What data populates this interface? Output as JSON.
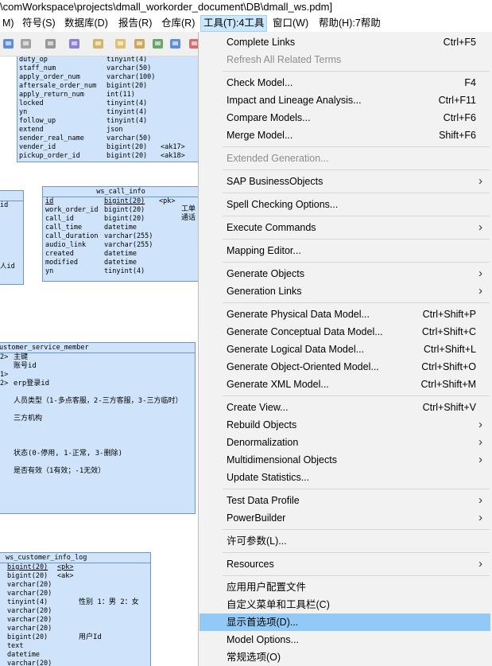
{
  "window": {
    "title": "\\comWorkspace\\projects\\dmall_workorder_document\\DB\\dmall_ws.pdm]"
  },
  "menubar": [
    {
      "label": "M)",
      "active": false
    },
    {
      "label": "符号(S)",
      "active": false
    },
    {
      "label": "数据库(D)",
      "active": false
    },
    {
      "label": "报告(R)",
      "active": false
    },
    {
      "label": "仓库(R)",
      "active": false
    },
    {
      "label": "工具(T):4工具",
      "active": true
    },
    {
      "label": "窗口(W)",
      "active": false
    },
    {
      "label": "帮助(H):7帮助",
      "active": false
    }
  ],
  "toolbar": {
    "icons": [
      "undo-icon",
      "redo-icon",
      "copy-icon",
      "properties-icon",
      "cut-icon",
      "paste-icon",
      "find-icon",
      "refresh-icon",
      "check-icon",
      "print-icon"
    ]
  },
  "diagram": {
    "table_top": {
      "rows": [
        [
          "duty_op",
          "tinyint(4)",
          ""
        ],
        [
          "staff_num",
          "varchar(50)",
          ""
        ],
        [
          "apply_order_num",
          "varchar(100)",
          ""
        ],
        [
          "aftersale_order_num",
          "bigint(20)",
          ""
        ],
        [
          "apply_return_num",
          "int(11)",
          ""
        ],
        [
          "locked",
          "tinyint(4)",
          ""
        ],
        [
          "yn",
          "tinyint(4)",
          ""
        ],
        [
          "follow_up",
          "tinyint(4)",
          ""
        ],
        [
          "extend",
          "json",
          ""
        ],
        [
          "sender_real_name",
          "varchar(50)",
          ""
        ],
        [
          "vender_id",
          "bigint(20)",
          "<ak17>"
        ],
        [
          "pickup_order_id",
          "bigint(20)",
          "<ak18>"
        ]
      ]
    },
    "table_left_mid": {
      "rows": [
        "id",
        "",
        "",
        "",
        "",
        "",
        "",
        "人id"
      ]
    },
    "ws_call_info": {
      "name": "ws_call_info",
      "rows": [
        [
          "id",
          "bigint(20)",
          "<pk>"
        ],
        [
          "work_order_id",
          "bigint(20)",
          ""
        ],
        [
          "call_id",
          "bigint(20)",
          ""
        ],
        [
          "call_time",
          "datetime",
          ""
        ],
        [
          "call_duration",
          "varchar(255)",
          ""
        ],
        [
          "audio_link",
          "varchar(255)",
          ""
        ],
        [
          "created",
          "datetime",
          ""
        ],
        [
          "modified",
          "datetime",
          ""
        ],
        [
          "yn",
          "tinyint(4)",
          ""
        ]
      ],
      "comments": [
        "工单",
        "通话"
      ]
    },
    "customer_service_member": {
      "name": "ustomer_service_member",
      "rows": [
        [
          "2>",
          "主键"
        ],
        [
          "",
          "账号id"
        ],
        [
          "1>",
          ""
        ],
        [
          "2>",
          "erp登录id"
        ],
        [
          "",
          ""
        ],
        [
          "",
          "人员类型（1-多点客服，2-三方客服，3-三方临时）"
        ],
        [
          "",
          ""
        ],
        [
          "",
          "三方机构"
        ],
        [
          "",
          ""
        ],
        [
          "",
          ""
        ],
        [
          "",
          ""
        ],
        [
          "",
          "状态(0-停用, 1-正常, 3-删除)"
        ],
        [
          "",
          ""
        ],
        [
          "",
          "是否有效（1有效；-1无效）"
        ]
      ]
    },
    "ws_customer_info_log": {
      "name": "ws_customer_info_log",
      "rows": [
        [
          "bigint(20)",
          "<pk>",
          ""
        ],
        [
          "bigint(20)",
          "<ak>",
          ""
        ],
        [
          "varchar(20)",
          "",
          ""
        ],
        [
          "varchar(20)",
          "",
          ""
        ],
        [
          "tinyint(4)",
          "",
          "性别 1：男 2：女"
        ],
        [
          "varchar(20)",
          "",
          ""
        ],
        [
          "varchar(20)",
          "",
          ""
        ],
        [
          "varchar(20)",
          "",
          ""
        ],
        [
          "bigint(20)",
          "",
          "用户Id"
        ],
        [
          "text",
          "",
          ""
        ],
        [
          "datetime",
          "",
          ""
        ],
        [
          "varchar(20)",
          "",
          ""
        ],
        [
          "datetime",
          "",
          ""
        ]
      ]
    }
  },
  "tools_menu": {
    "items": [
      {
        "label": "Complete Links",
        "shortcut": "Ctrl+F5"
      },
      {
        "label": "Refresh All Related Terms",
        "shortcut": "",
        "disabled": true
      },
      {
        "sep": true
      },
      {
        "label": "Check Model...",
        "shortcut": "F4"
      },
      {
        "label": "Impact and Lineage Analysis...",
        "shortcut": "Ctrl+F11"
      },
      {
        "label": "Compare Models...",
        "shortcut": "Ctrl+F6"
      },
      {
        "label": "Merge Model...",
        "shortcut": "Shift+F6"
      },
      {
        "sep": true
      },
      {
        "label": "Extended Generation...",
        "shortcut": "",
        "disabled": true
      },
      {
        "sep": true
      },
      {
        "label": "SAP BusinessObjects",
        "submenu": true
      },
      {
        "sep": true
      },
      {
        "label": "Spell Checking Options..."
      },
      {
        "sep": true
      },
      {
        "label": "Execute Commands",
        "submenu": true
      },
      {
        "sep": true
      },
      {
        "label": "Mapping Editor..."
      },
      {
        "sep": true
      },
      {
        "label": "Generate Objects",
        "submenu": true
      },
      {
        "label": "Generation Links",
        "submenu": true
      },
      {
        "sep": true
      },
      {
        "label": "Generate Physical Data Model...",
        "shortcut": "Ctrl+Shift+P"
      },
      {
        "label": "Generate Conceptual Data Model...",
        "shortcut": "Ctrl+Shift+C"
      },
      {
        "label": "Generate Logical Data Model...",
        "shortcut": "Ctrl+Shift+L"
      },
      {
        "label": "Generate Object-Oriented Model...",
        "shortcut": "Ctrl+Shift+O"
      },
      {
        "label": "Generate XML Model...",
        "shortcut": "Ctrl+Shift+M"
      },
      {
        "sep": true
      },
      {
        "label": "Create View...",
        "shortcut": "Ctrl+Shift+V"
      },
      {
        "label": "Rebuild Objects",
        "submenu": true
      },
      {
        "label": "Denormalization",
        "submenu": true
      },
      {
        "label": "Multidimensional Objects",
        "submenu": true
      },
      {
        "label": "Update Statistics..."
      },
      {
        "sep": true
      },
      {
        "label": "Test Data Profile",
        "submenu": true
      },
      {
        "label": "PowerBuilder",
        "submenu": true
      },
      {
        "sep": true
      },
      {
        "label": "许可参数(L)..."
      },
      {
        "sep": true
      },
      {
        "label": "Resources",
        "submenu": true
      },
      {
        "sep": true
      },
      {
        "label": "应用用户配置文件"
      },
      {
        "label": "自定义菜单和工具栏(C)"
      },
      {
        "label": "显示首选项(D)...",
        "highlighted": true
      },
      {
        "label": "Model Options..."
      },
      {
        "label": "常规选项(O)"
      }
    ]
  }
}
